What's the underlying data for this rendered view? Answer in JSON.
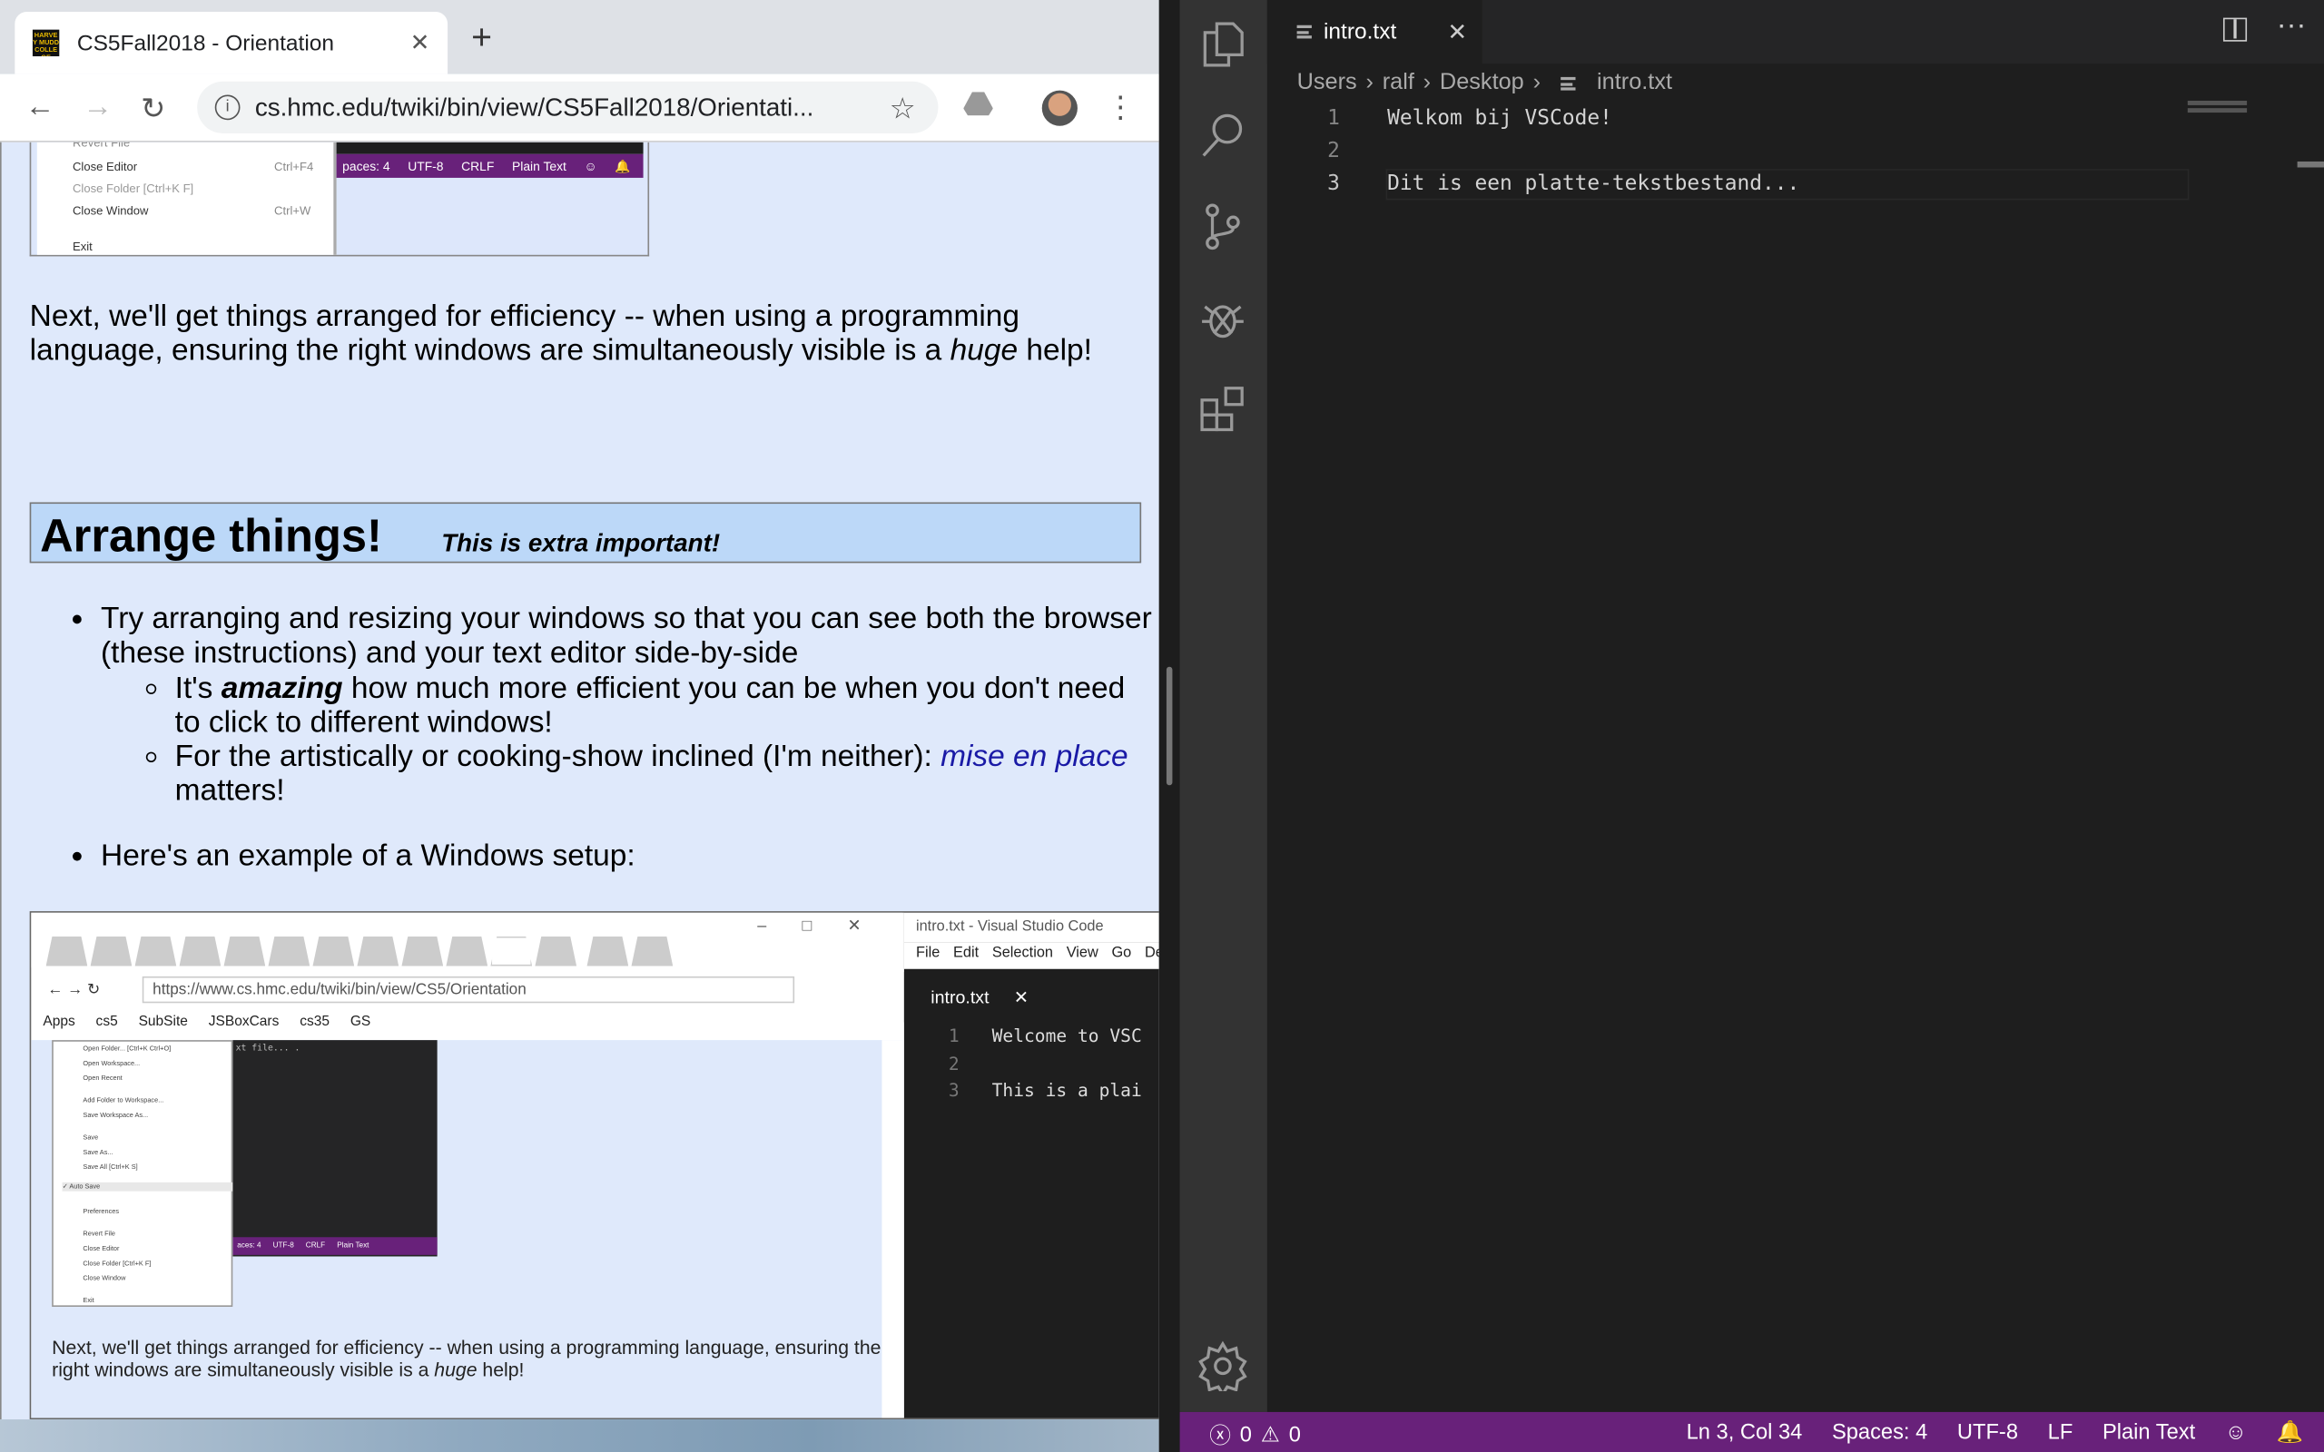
{
  "browser": {
    "tab_title": "CS5Fall2018 - Orientation",
    "favicon_text": "HARVEY MUDD COLLEGE",
    "url": "cs.hmc.edu/twiki/bin/view/CS5Fall2018/Orientati...",
    "new_tab": "+",
    "close_tab": "✕"
  },
  "page": {
    "shot1": {
      "menu_items": [
        {
          "label": "Revert File",
          "shortcut": ""
        },
        {
          "label": "Close Editor",
          "shortcut": "Ctrl+F4"
        },
        {
          "label": "Close Folder [Ctrl+K F]",
          "shortcut": ""
        },
        {
          "label": "Close Window",
          "shortcut": "Ctrl+W"
        },
        {
          "label": "Exit",
          "shortcut": ""
        }
      ],
      "status": [
        "paces: 4",
        "UTF-8",
        "CRLF",
        "Plain Text"
      ]
    },
    "para1_a": "Next, we'll get things arranged for efficiency -- when using a programming language, ensuring the right windows are simultaneously visible is a ",
    "para1_em": "huge",
    "para1_b": " help!",
    "heading": "Arrange things!",
    "heading_note": "This is extra important!",
    "bullet1": "Try arranging and resizing your windows so that you can see both the browser (these instructions) and your text editor side-by-side",
    "sub1_a": "It's ",
    "sub1_em": "amazing",
    "sub1_b": " how much more efficient you can be when you don't need to click to different windows!",
    "sub2_a": "For the artistically or cooking-show inclined (I'm neither): ",
    "sub2_link": "mise en place",
    "sub2_b": " matters!",
    "bullet2": "Here's an example of a Windows setup:",
    "shot2": {
      "url": "https://www.cs.hmc.edu/twiki/bin/view/CS5/Orientation",
      "bookmarks": [
        "Apps",
        "cs5",
        "SubSite",
        "JSBoxCars",
        "cs35",
        "GS"
      ],
      "menu_items": [
        "Open Folder... [Ctrl+K Ctrl+O]",
        "Open Workspace...",
        "Open Recent",
        "Add Folder to Workspace...",
        "Save Workspace As...",
        "Save",
        "Save As...",
        "Save All [Ctrl+K S]",
        "✓ Auto Save",
        "Preferences",
        "Revert File",
        "Close Editor",
        "Close Folder [Ctrl+K F]",
        "Close Window",
        "Exit"
      ],
      "dark_text": "xt file... .",
      "status": [
        "aces: 4",
        "UTF-8",
        "CRLF",
        "Plain Text"
      ],
      "text_a": "Next, we'll get things arranged for efficiency -- when using a programming language, ensuring the right windows are simultaneously visible is a ",
      "text_em": "huge",
      "text_b": " help!",
      "vs_title": "intro.txt - Visual Studio Code",
      "vs_menu": [
        "File",
        "Edit",
        "Selection",
        "View",
        "Go",
        "De"
      ],
      "vs_tab": "intro.txt",
      "vs_close": "✕",
      "vs_lines": [
        {
          "n": "1",
          "t": "Welcome to VSC"
        },
        {
          "n": "2",
          "t": ""
        },
        {
          "n": "3",
          "t": "This is a plai"
        }
      ]
    }
  },
  "vscode": {
    "tab": "intro.txt",
    "tab_close": "✕",
    "more": "···",
    "breadcrumbs": [
      "Users",
      "ralf",
      "Desktop",
      "intro.txt"
    ],
    "lines": [
      {
        "n": "1",
        "t": "Welkom bij VSCode!"
      },
      {
        "n": "2",
        "t": ""
      },
      {
        "n": "3",
        "t": "Dit is een platte-tekstbestand..."
      }
    ],
    "status": {
      "errors": "0",
      "warnings": "0",
      "position": "Ln 3, Col 34",
      "spaces": "Spaces: 4",
      "encoding": "UTF-8",
      "eol": "LF",
      "language": "Plain Text"
    },
    "status_color": "#68217a"
  }
}
